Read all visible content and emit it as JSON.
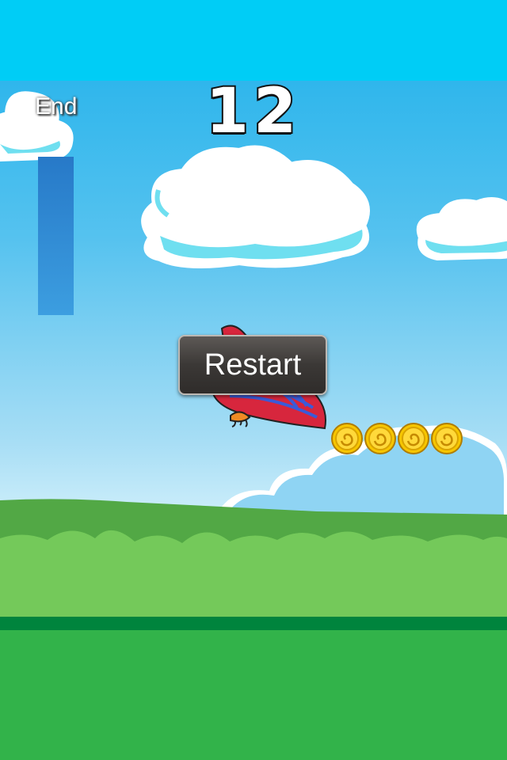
{
  "hud": {
    "score": "12",
    "end_label": "End",
    "progress": 1.0
  },
  "menu": {
    "restart_label": "Restart"
  },
  "coins": [
    {
      "id": "coin-1",
      "icon": "coin-icon"
    },
    {
      "id": "coin-2",
      "icon": "coin-icon"
    },
    {
      "id": "coin-3",
      "icon": "coin-icon"
    },
    {
      "id": "coin-4",
      "icon": "coin-icon"
    }
  ],
  "colors": {
    "sky_top": "#00cdf6",
    "sky": "#4dbdee",
    "grass": "#74c95a",
    "ground": "#32b34a",
    "ground_edge": "#00843d",
    "progress": "#2f8bd6",
    "bird": "#d7263d",
    "coin": "#f7c600"
  },
  "icons": {
    "player": "red-bird-icon",
    "coin": "coin-icon",
    "cloud": "cloud-icon"
  }
}
